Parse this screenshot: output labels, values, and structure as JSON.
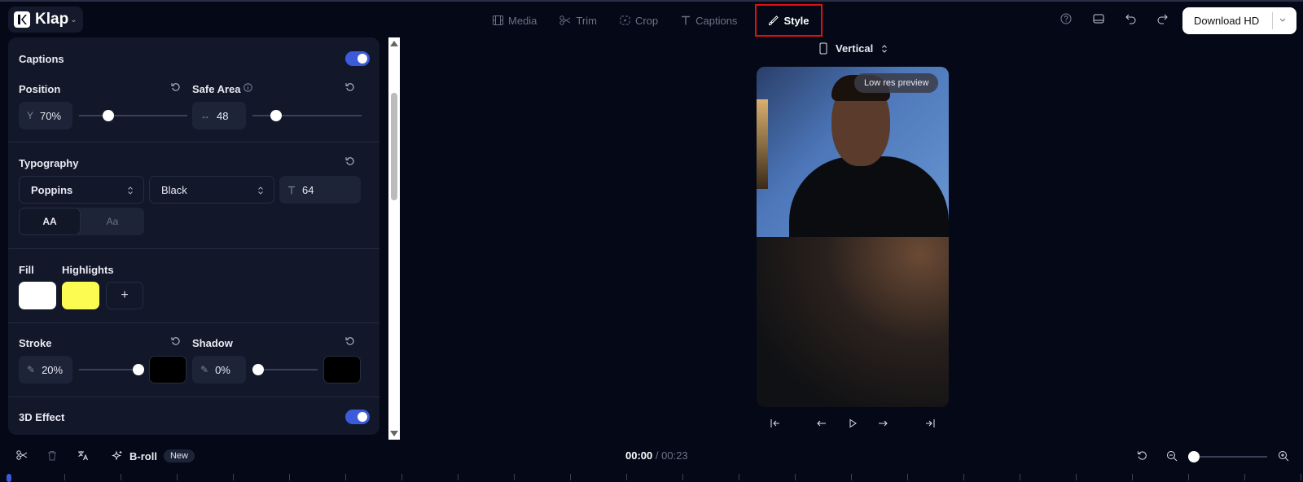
{
  "app": {
    "name": "Klap"
  },
  "tabs": [
    {
      "label": "Media",
      "icon": "film-icon"
    },
    {
      "label": "Trim",
      "icon": "scissors-icon"
    },
    {
      "label": "Crop",
      "icon": "crop-icon"
    },
    {
      "label": "Captions",
      "icon": "text-icon"
    },
    {
      "label": "Style",
      "icon": "brush-icon",
      "active": true
    }
  ],
  "download": {
    "label": "Download HD"
  },
  "panel": {
    "captions": {
      "label": "Captions",
      "enabled": true
    },
    "position": {
      "label": "Position",
      "axis": "Y",
      "value": "70%",
      "slider": 0.27
    },
    "safe_area": {
      "label": "Safe Area",
      "value": "48",
      "slider": 0.2
    },
    "typography": {
      "label": "Typography",
      "font": "Poppins",
      "weight": "Black",
      "size": "64",
      "case_upper": "AA",
      "case_title": "Aa",
      "case_selected": "AA"
    },
    "fill": {
      "label": "Fill",
      "color": "#ffffff"
    },
    "highlights": {
      "label": "Highlights",
      "color": "#fbfb52",
      "add_label": "+"
    },
    "stroke": {
      "label": "Stroke",
      "value": "20%",
      "slider": 1.0,
      "color": "#000000"
    },
    "shadow": {
      "label": "Shadow",
      "value": "0%",
      "slider": 0.0,
      "color": "#000000"
    },
    "effect_3d": {
      "label": "3D Effect",
      "enabled": true
    }
  },
  "preview": {
    "orientation": "Vertical",
    "badge": "Low res preview"
  },
  "timeline": {
    "broll_label": "B-roll",
    "new_badge": "New",
    "current_time": "00:00",
    "separator": "/",
    "total_time": "00:23",
    "zoom": 0.0
  },
  "colors": {
    "accent": "#3b5bdb",
    "highlight_frame": "#e01010",
    "background": "#050816",
    "panel": "#121829"
  }
}
